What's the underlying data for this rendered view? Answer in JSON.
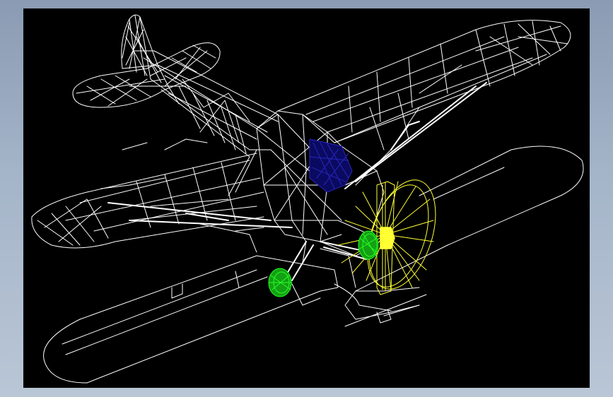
{
  "app": {
    "background": "#a5b5c9",
    "viewport_background": "#000000"
  },
  "model": {
    "subject": "light-aircraft-on-floats-wireframe",
    "colors": {
      "airframe": "#ffffff",
      "propeller": "#ffff33",
      "engine_hub": "#22ff22",
      "cockpit_glass": "#1a1aa0",
      "floats": "#ffffff"
    }
  }
}
